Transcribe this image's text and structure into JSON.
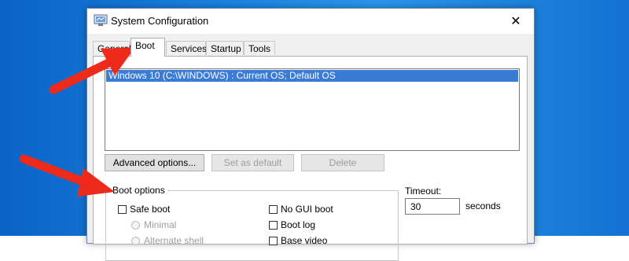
{
  "window": {
    "title": "System Configuration",
    "close_glyph": "✕"
  },
  "tabs": [
    {
      "label": "General"
    },
    {
      "label": "Boot"
    },
    {
      "label": "Services"
    },
    {
      "label": "Startup"
    },
    {
      "label": "Tools"
    }
  ],
  "active_tab": "Boot",
  "os_list": {
    "items": [
      "Windows 10 (C:\\WINDOWS) : Current OS; Default OS"
    ],
    "selected_index": 0
  },
  "buttons": {
    "advanced": "Advanced options...",
    "set_default": "Set as default",
    "delete": "Delete"
  },
  "boot_options": {
    "label": "Boot options",
    "safe_boot": "Safe boot",
    "minimal": "Minimal",
    "alternate_shell": "Alternate shell",
    "no_gui_boot": "No GUI boot",
    "boot_log": "Boot log",
    "base_video": "Base video"
  },
  "timeout": {
    "label": "Timeout:",
    "value": "30",
    "unit": "seconds"
  },
  "colors": {
    "annotation_arrow": "#ee2a1b",
    "selection": "#3a7bd5"
  }
}
